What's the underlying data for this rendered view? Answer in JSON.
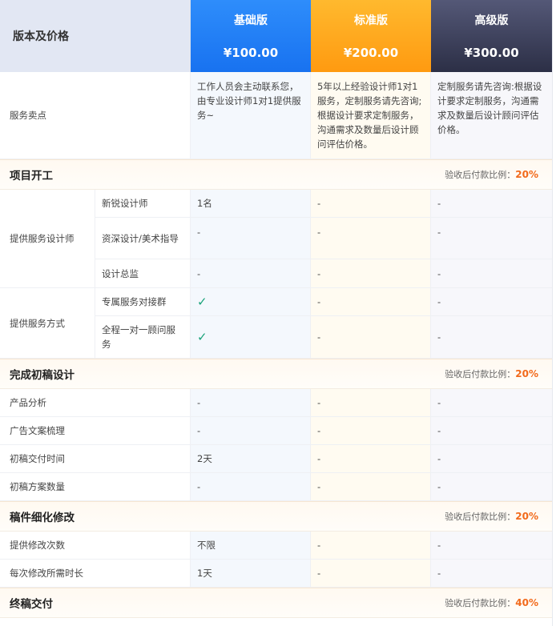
{
  "header": {
    "title": "版本及价格",
    "plans": [
      {
        "name": "基础版",
        "price": "¥100.00"
      },
      {
        "name": "标准版",
        "price": "¥200.00"
      },
      {
        "name": "高级版",
        "price": "¥300.00"
      }
    ]
  },
  "service_points": {
    "label": "服务卖点",
    "basic": "工作人员会主动联系您，由专业设计师1对1提供服务~",
    "standard": "5年以上经验设计师1对1服务，定制服务请先咨询;根据设计要求定制服务，沟通需求及数量后设计顾问评估价格。",
    "advanced": "定制服务请先咨询:根据设计要求定制服务，沟通需求及数量后设计顾问评估价格。"
  },
  "ratio_label": "验收后付款比例：",
  "sections": [
    {
      "title": "项目开工",
      "ratio": "20%"
    },
    {
      "title": "完成初稿设计",
      "ratio": "20%"
    },
    {
      "title": "稿件细化修改",
      "ratio": "20%"
    },
    {
      "title": "终稿交付",
      "ratio": "40%"
    }
  ],
  "designers": {
    "label": "提供服务设计师",
    "rows": [
      {
        "label": "新锐设计师",
        "basic": "1名",
        "standard": "-",
        "advanced": "-"
      },
      {
        "label": "资深设计/美术指导",
        "basic": "-",
        "standard": "-",
        "advanced": "-"
      },
      {
        "label": "设计总监",
        "basic": "-",
        "standard": "-",
        "advanced": "-"
      }
    ]
  },
  "service_mode": {
    "label": "提供服务方式",
    "rows": [
      {
        "label": "专属服务对接群",
        "basic": "check",
        "standard": "-",
        "advanced": "-"
      },
      {
        "label": "全程一对一顾问服务",
        "basic": "check",
        "standard": "-",
        "advanced": "-"
      }
    ]
  },
  "draft_rows": [
    {
      "label": "产品分析",
      "basic": "-",
      "standard": "-",
      "advanced": "-"
    },
    {
      "label": "广告文案梳理",
      "basic": "-",
      "standard": "-",
      "advanced": "-"
    },
    {
      "label": "初稿交付时间",
      "basic": "2天",
      "standard": "-",
      "advanced": "-"
    },
    {
      "label": "初稿方案数量",
      "basic": "-",
      "standard": "-",
      "advanced": "-"
    }
  ],
  "revision_rows": [
    {
      "label": "提供修改次数",
      "basic": "不限",
      "standard": "-",
      "advanced": "-"
    },
    {
      "label": "每次修改所需时长",
      "basic": "1天",
      "standard": "-",
      "advanced": "-"
    }
  ],
  "icons": {
    "check": "check-icon"
  },
  "colors": {
    "basic": "#1872f0",
    "standard": "#ff9a10",
    "advanced": "#2c2f46",
    "ratio": "#f26a1b",
    "check": "#1aa37a"
  }
}
